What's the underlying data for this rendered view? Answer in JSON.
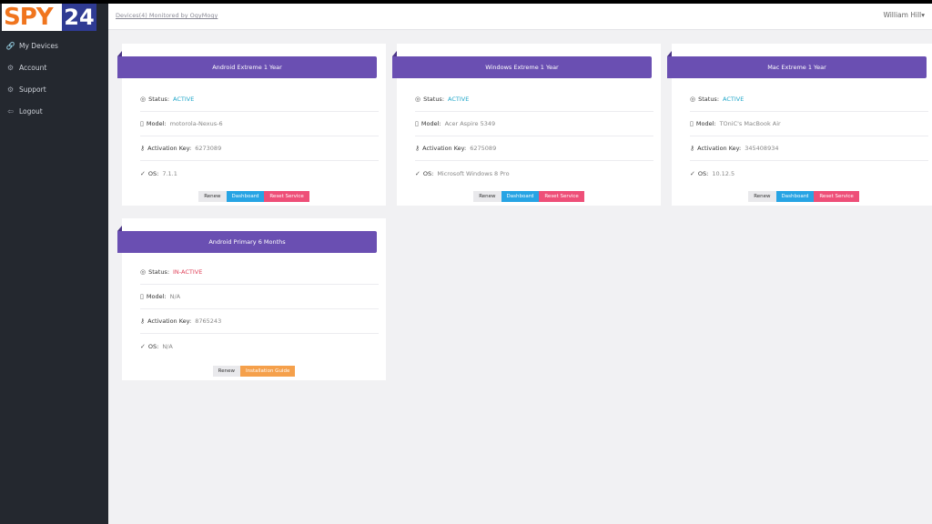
{
  "logo": {
    "spy": "SPY",
    "num": "24"
  },
  "sidebar": {
    "items": [
      {
        "label": "My Devices",
        "icon": "🔗"
      },
      {
        "label": "Account",
        "icon": "⚙"
      },
      {
        "label": "Support",
        "icon": "⚙"
      },
      {
        "label": "Logout",
        "icon": "⇦"
      }
    ]
  },
  "topbar": {
    "breadcrumb": "Devices(4) Monitored by OgyMogy",
    "user": "William Hill▾"
  },
  "labels": {
    "status": "Status:",
    "model": "Model:",
    "activation": "Activation Key:",
    "os": "OS:",
    "renew": "Renew",
    "dashboard": "Dashboard",
    "reset": "Reset Service",
    "guide": "Installation Guide"
  },
  "cards": [
    {
      "title": "Android Extreme 1 Year",
      "status": "ACTIVE",
      "model": "motorola-Nexus-6",
      "key": "6273089",
      "os": "7.1.1"
    },
    {
      "title": "Windows Extreme 1 Year",
      "status": "ACTIVE",
      "model": "Acer Aspire 5349",
      "key": "6275089",
      "os": "Microsoft Windows 8 Pro"
    },
    {
      "title": "Mac Extreme 1 Year",
      "status": "ACTIVE",
      "model": "TOniC's MacBook Air",
      "key": "345408934",
      "os": "10.12.5"
    },
    {
      "title": "Android Primary 6 Months",
      "status": "IN-ACTIVE",
      "model": "N/A",
      "key": "8765243",
      "os": "N/A"
    }
  ]
}
